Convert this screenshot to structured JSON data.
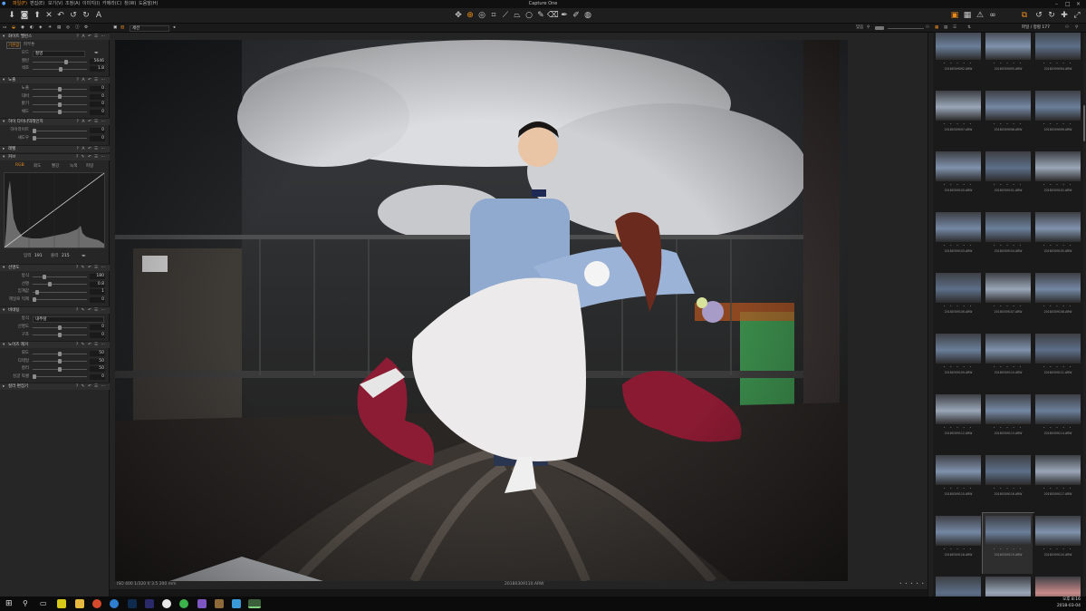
{
  "menubar": {
    "items": [
      "파일(F)",
      "편집(E)",
      "보기(V)",
      "조정(A)",
      "이미지(I)",
      "카메라(C)",
      "창(W)",
      "도움말(H)"
    ],
    "app_title": "Capture One",
    "active_item_index": 0
  },
  "subbar": {
    "view_select": "세션",
    "zoom_label": "맞음",
    "browser_title": "파일 / 정렬 177"
  },
  "left_panel": {
    "white_balance": {
      "header": "화이트 밸런스",
      "tabs": [
        "기본값",
        "피부톤"
      ],
      "mode_label": "모드",
      "mode_value": "촬영",
      "kelvin_label": "켈빈",
      "kelvin_value": "5646",
      "kelvin_fraction": 0.62,
      "tint_label": "색조",
      "tint_value": "1.8",
      "tint_fraction": 0.52
    },
    "exposure": {
      "header": "노출",
      "rows": [
        {
          "label": "노출",
          "value": "0",
          "fraction": 0.5
        },
        {
          "label": "대비",
          "value": "0",
          "fraction": 0.5
        },
        {
          "label": "밝기",
          "value": "0",
          "fraction": 0.5
        },
        {
          "label": "채도",
          "value": "0",
          "fraction": 0.5
        }
      ]
    },
    "hdr": {
      "header": "하이 다이나믹레인지",
      "rows": [
        {
          "label": "하이라이트",
          "value": "0",
          "fraction": 0.0
        },
        {
          "label": "섀도우",
          "value": "0",
          "fraction": 0.0
        }
      ]
    },
    "levels_header": "레벨",
    "curve": {
      "header": "커브",
      "tabs": [
        "RGB",
        "휘도",
        "빨강",
        "녹색",
        "파랑"
      ],
      "input_label": "입력",
      "input_value": "191",
      "output_label": "출력",
      "output_value": "215"
    },
    "clarity": {
      "header": "선명도",
      "rows": [
        {
          "label": "방식",
          "value": "180",
          "fraction": 0.2
        },
        {
          "label": "선명",
          "value": "0.8",
          "fraction": 0.3
        },
        {
          "label": "임계값",
          "value": "1",
          "fraction": 0.05
        },
        {
          "label": "헤일로 억제",
          "value": "0",
          "fraction": 0.0
        }
      ]
    },
    "vignette": {
      "header": "비네팅",
      "method_label": "방식",
      "method_value": "내추럴",
      "rows": [
        {
          "label": "선명도",
          "value": "0",
          "fraction": 0.5
        },
        {
          "label": "구조",
          "value": "0",
          "fraction": 0.5
        }
      ]
    },
    "noise": {
      "header": "노이즈 제거",
      "rows": [
        {
          "label": "휘도",
          "value": "50",
          "fraction": 0.5
        },
        {
          "label": "디테일",
          "value": "50",
          "fraction": 0.5
        },
        {
          "label": "컬러",
          "value": "50",
          "fraction": 0.5
        },
        {
          "label": "싱글 픽셀",
          "value": "0",
          "fraction": 0.0
        }
      ]
    },
    "color_editor_header": "컬러 편집기"
  },
  "viewer": {
    "exif_caption": "ISO 400  1/320 f/ 3.5  200 mm",
    "filename_caption": "20180309110.ARW",
    "page_dots": "• • • • •"
  },
  "browser": {
    "rating_dots": "• • • • •",
    "filenames": [
      "20180309092.ARW",
      "20180309093.ARW",
      "20180309094.ARW",
      "20180309097.ARW",
      "20180309098.ARW",
      "20180309099.ARW",
      "20180309100.ARW",
      "20180309101.ARW",
      "20180309102.ARW",
      "20180309103.ARW",
      "20180309104.ARW",
      "20180309105.ARW",
      "20180309106.ARW",
      "20180309107.ARW",
      "20180309108.ARW",
      "20180309109.ARW",
      "20180309110.ARW",
      "20180309111.ARW",
      "20180309112.ARW",
      "20180309113.ARW",
      "20180309114.ARW",
      "20180309115.ARW",
      "20180309116.ARW",
      "20180309117.ARW",
      "20180309118.ARW",
      "20180309119.ARW",
      "20180309120.ARW",
      "20180309121.ARW",
      "20180309122.ARW",
      "20180309123.ARW"
    ],
    "selected_index": 25
  },
  "taskbar": {
    "time": "오후 8:16",
    "date": "2018-03-04"
  },
  "colors": {
    "accent": "#e88a1a",
    "panel_bg": "#262626",
    "viewer_bg": "#242424"
  }
}
